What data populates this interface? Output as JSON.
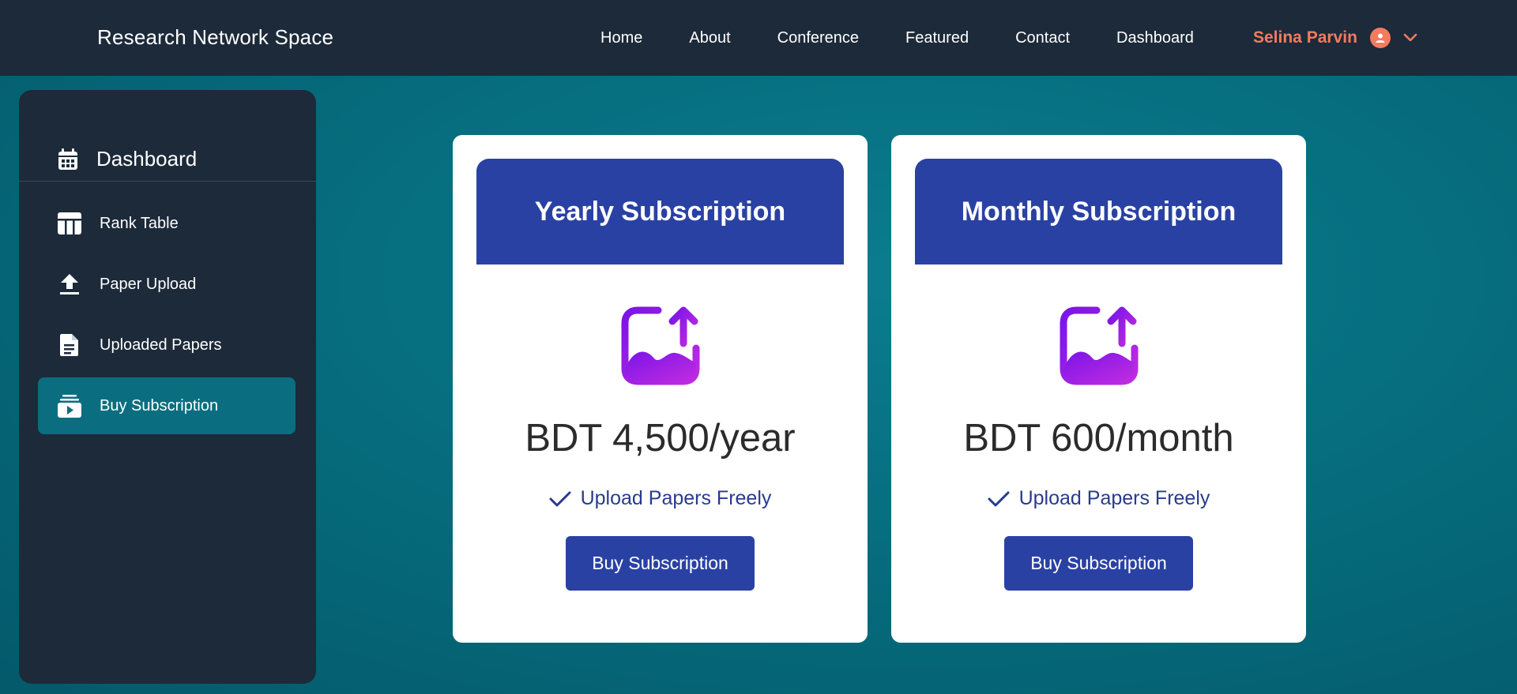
{
  "navbar": {
    "brand": "Research Network Space",
    "links": [
      "Home",
      "About",
      "Conference",
      "Featured",
      "Contact",
      "Dashboard"
    ],
    "user_name": "Selina Parvin",
    "accent_color": "#f47b5e"
  },
  "sidebar": {
    "title": "Dashboard",
    "items": [
      {
        "label": "Rank Table",
        "icon": "table-icon",
        "active": false
      },
      {
        "label": "Paper Upload",
        "icon": "upload-icon",
        "active": false
      },
      {
        "label": "Uploaded Papers",
        "icon": "document-icon",
        "active": false
      },
      {
        "label": "Buy Subscription",
        "icon": "subscription-icon",
        "active": true
      }
    ]
  },
  "plans": [
    {
      "title": "Yearly Subscription",
      "icon": "image-upload-icon",
      "price": "BDT 4,500/year",
      "feature": "Upload Papers Freely",
      "button_label": "Buy Subscription"
    },
    {
      "title": "Monthly Subscription",
      "icon": "image-upload-icon",
      "price": "BDT 600/month",
      "feature": "Upload Papers Freely",
      "button_label": "Buy Subscription"
    }
  ],
  "colors": {
    "nav_bg": "#1c2a3a",
    "plan_header": "#2a41a4",
    "sidebar_active": "#0a6e80"
  }
}
